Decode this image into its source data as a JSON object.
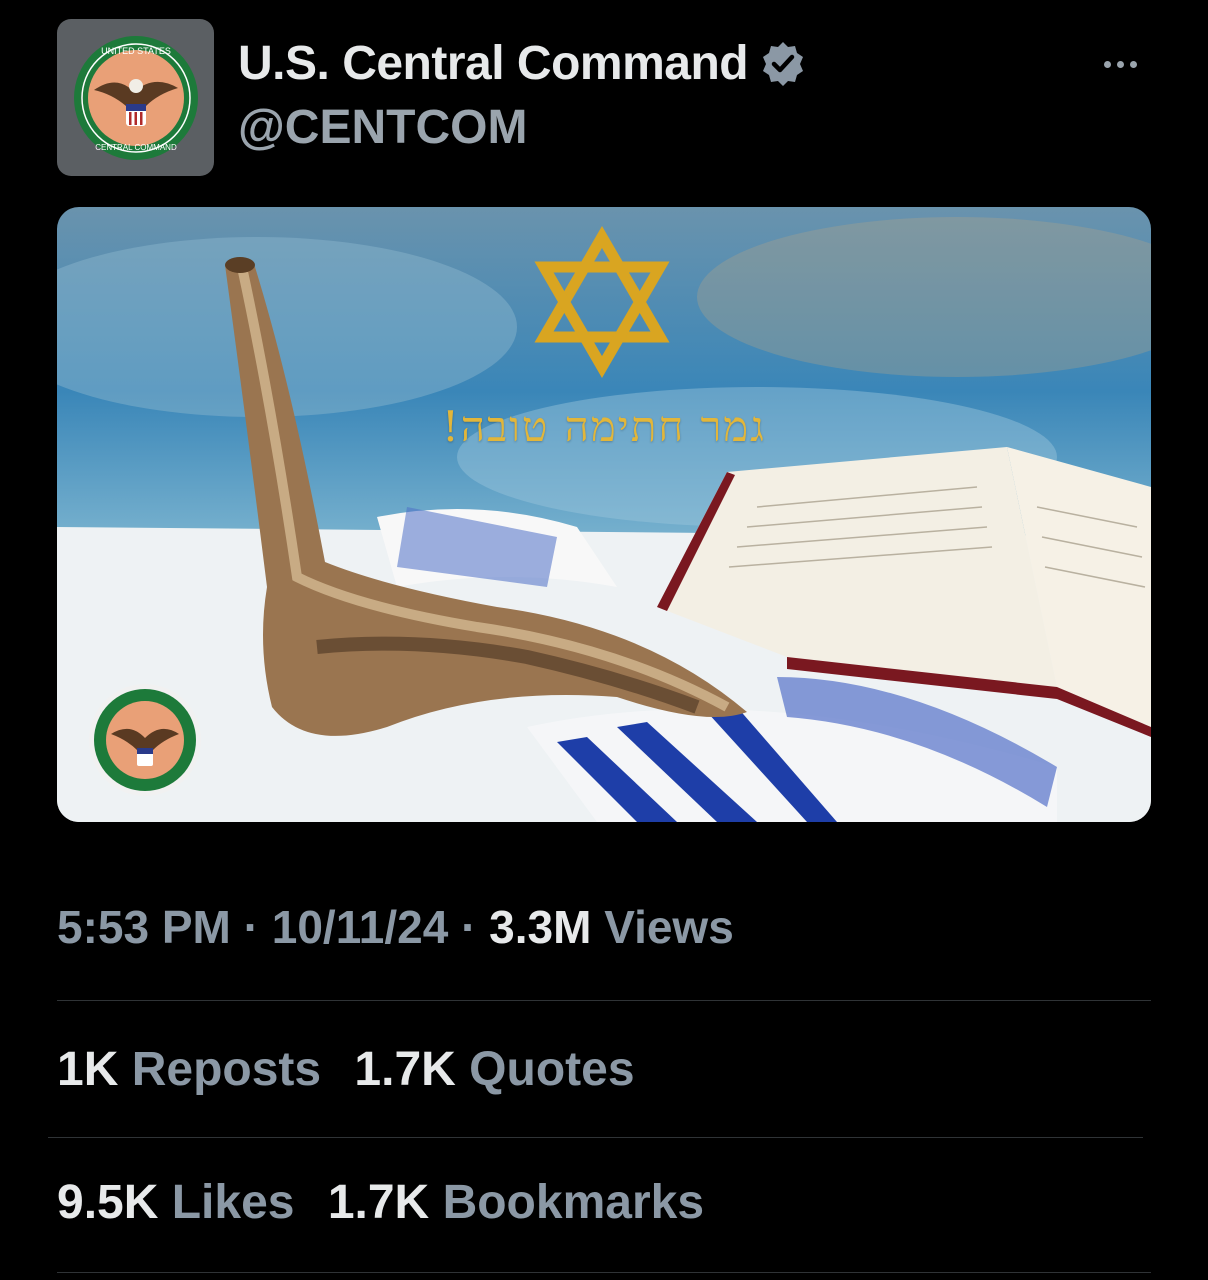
{
  "author": {
    "display_name": "U.S. Central Command",
    "handle": "@CENTCOM",
    "avatar_icon": "centcom-seal-icon",
    "verified_icon": "verified-badge-icon"
  },
  "menu_icon": "more-options-icon",
  "media": {
    "greeting_text": "גמר חתימה טובה!",
    "seal_text_top": "UNITED STATES",
    "seal_text_bottom": "CENTRAL COMMAND"
  },
  "meta": {
    "time": "5:53 PM",
    "separator": "·",
    "date": "10/11/24",
    "views_count": "3.3M",
    "views_label": "Views"
  },
  "stats_row1": [
    {
      "count": "1K",
      "label": "Reposts"
    },
    {
      "count": "1.7K",
      "label": "Quotes"
    }
  ],
  "stats_row2": [
    {
      "count": "9.5K",
      "label": "Likes"
    },
    {
      "count": "1.7K",
      "label": "Bookmarks"
    }
  ],
  "colors": {
    "background": "#000000",
    "primary_text": "#e7e9ea",
    "secondary_text": "#8b98a5",
    "divider": "#2f3336",
    "gold": "#e2b63a"
  }
}
